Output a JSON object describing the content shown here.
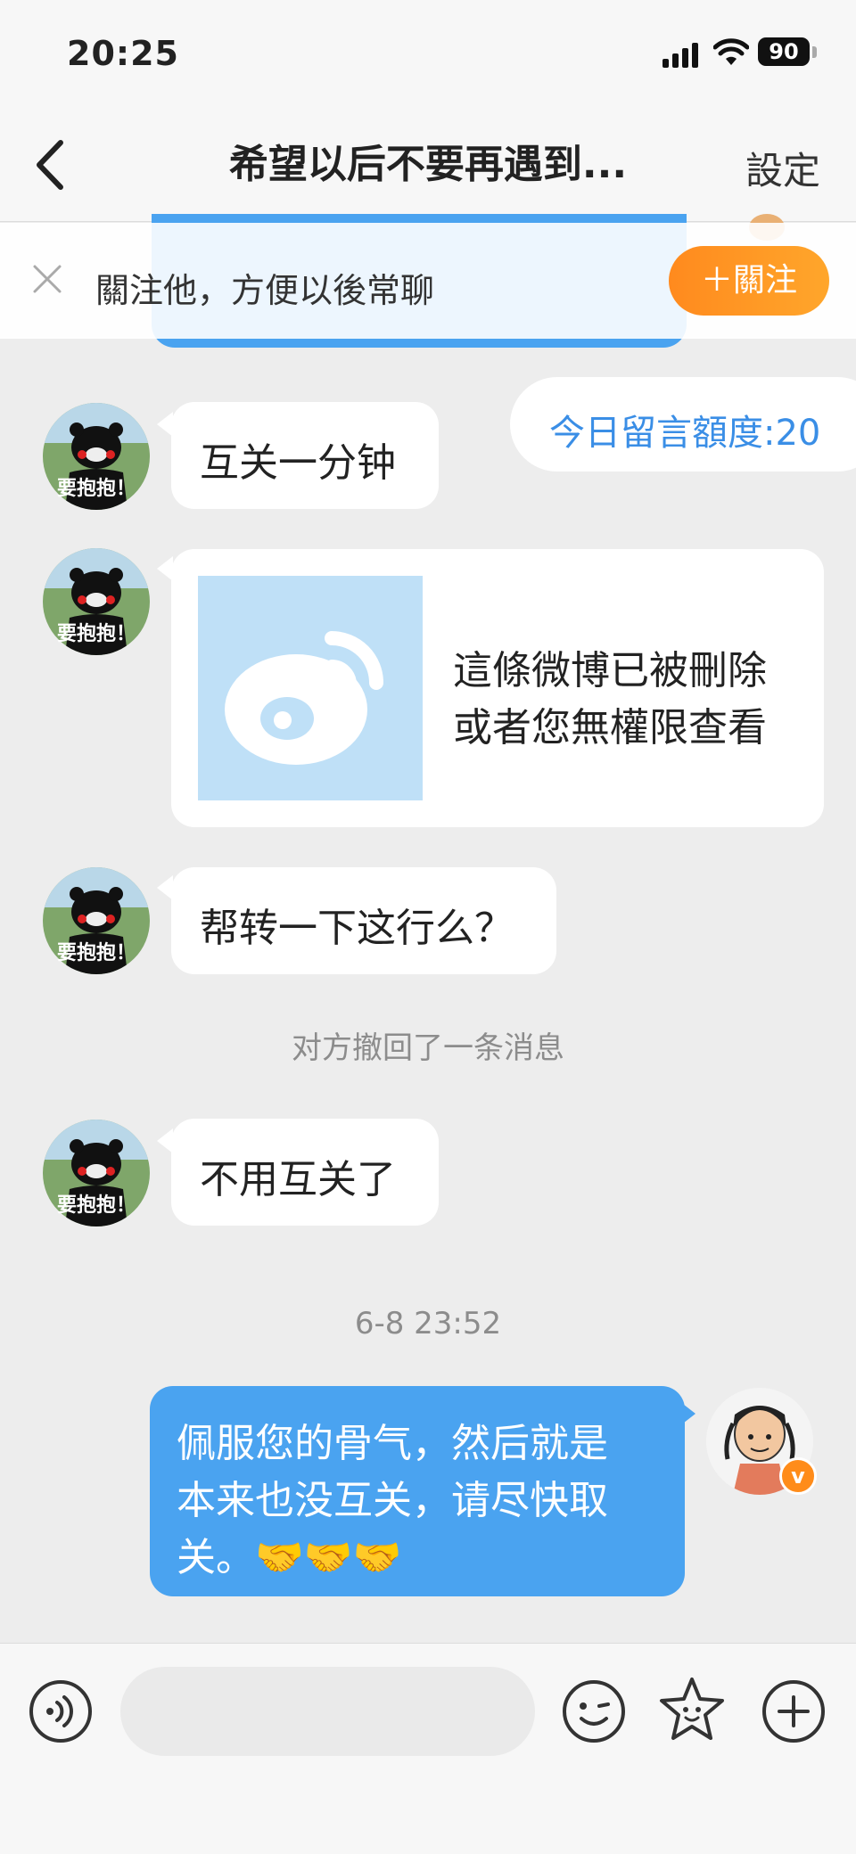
{
  "status_bar": {
    "time": "20:25",
    "battery": "90"
  },
  "nav": {
    "title": "希望以后不要再遇到...",
    "settings_label": "設定"
  },
  "follow_bar": {
    "text": "關注他，方便以後常聊",
    "button": "＋關注"
  },
  "quota": {
    "text": "今日留言額度:20"
  },
  "messages": [
    {
      "from": "other",
      "avatar_caption": "要抱抱！",
      "text": "互关一分钟"
    },
    {
      "from": "other",
      "avatar_caption": "要抱抱！",
      "deleted_line1": "這條微博已被刪除",
      "deleted_line2": "或者您無權限查看"
    },
    {
      "from": "other",
      "avatar_caption": "要抱抱！",
      "text": "帮转一下这行么？"
    },
    {
      "from": "other",
      "avatar_caption": "要抱抱！",
      "text": "不用互关了"
    }
  ],
  "recall_notice": "对方撤回了一条消息",
  "timestamp": "6-8 23:52",
  "sent": {
    "line1": "佩服您的骨气，然后就是",
    "line2": "本来也没互关，请尽快取",
    "line3": "关。🤝🤝🤝",
    "badge": "v"
  },
  "colors": {
    "accent_blue": "#4aa3f0",
    "follow_orange": "#ff8a1e",
    "quota_blue": "#3a8ee6"
  },
  "icons": [
    "back-chevron-icon",
    "close-icon",
    "voice-icon",
    "emoji-icon",
    "sticker-icon",
    "plus-icon"
  ]
}
